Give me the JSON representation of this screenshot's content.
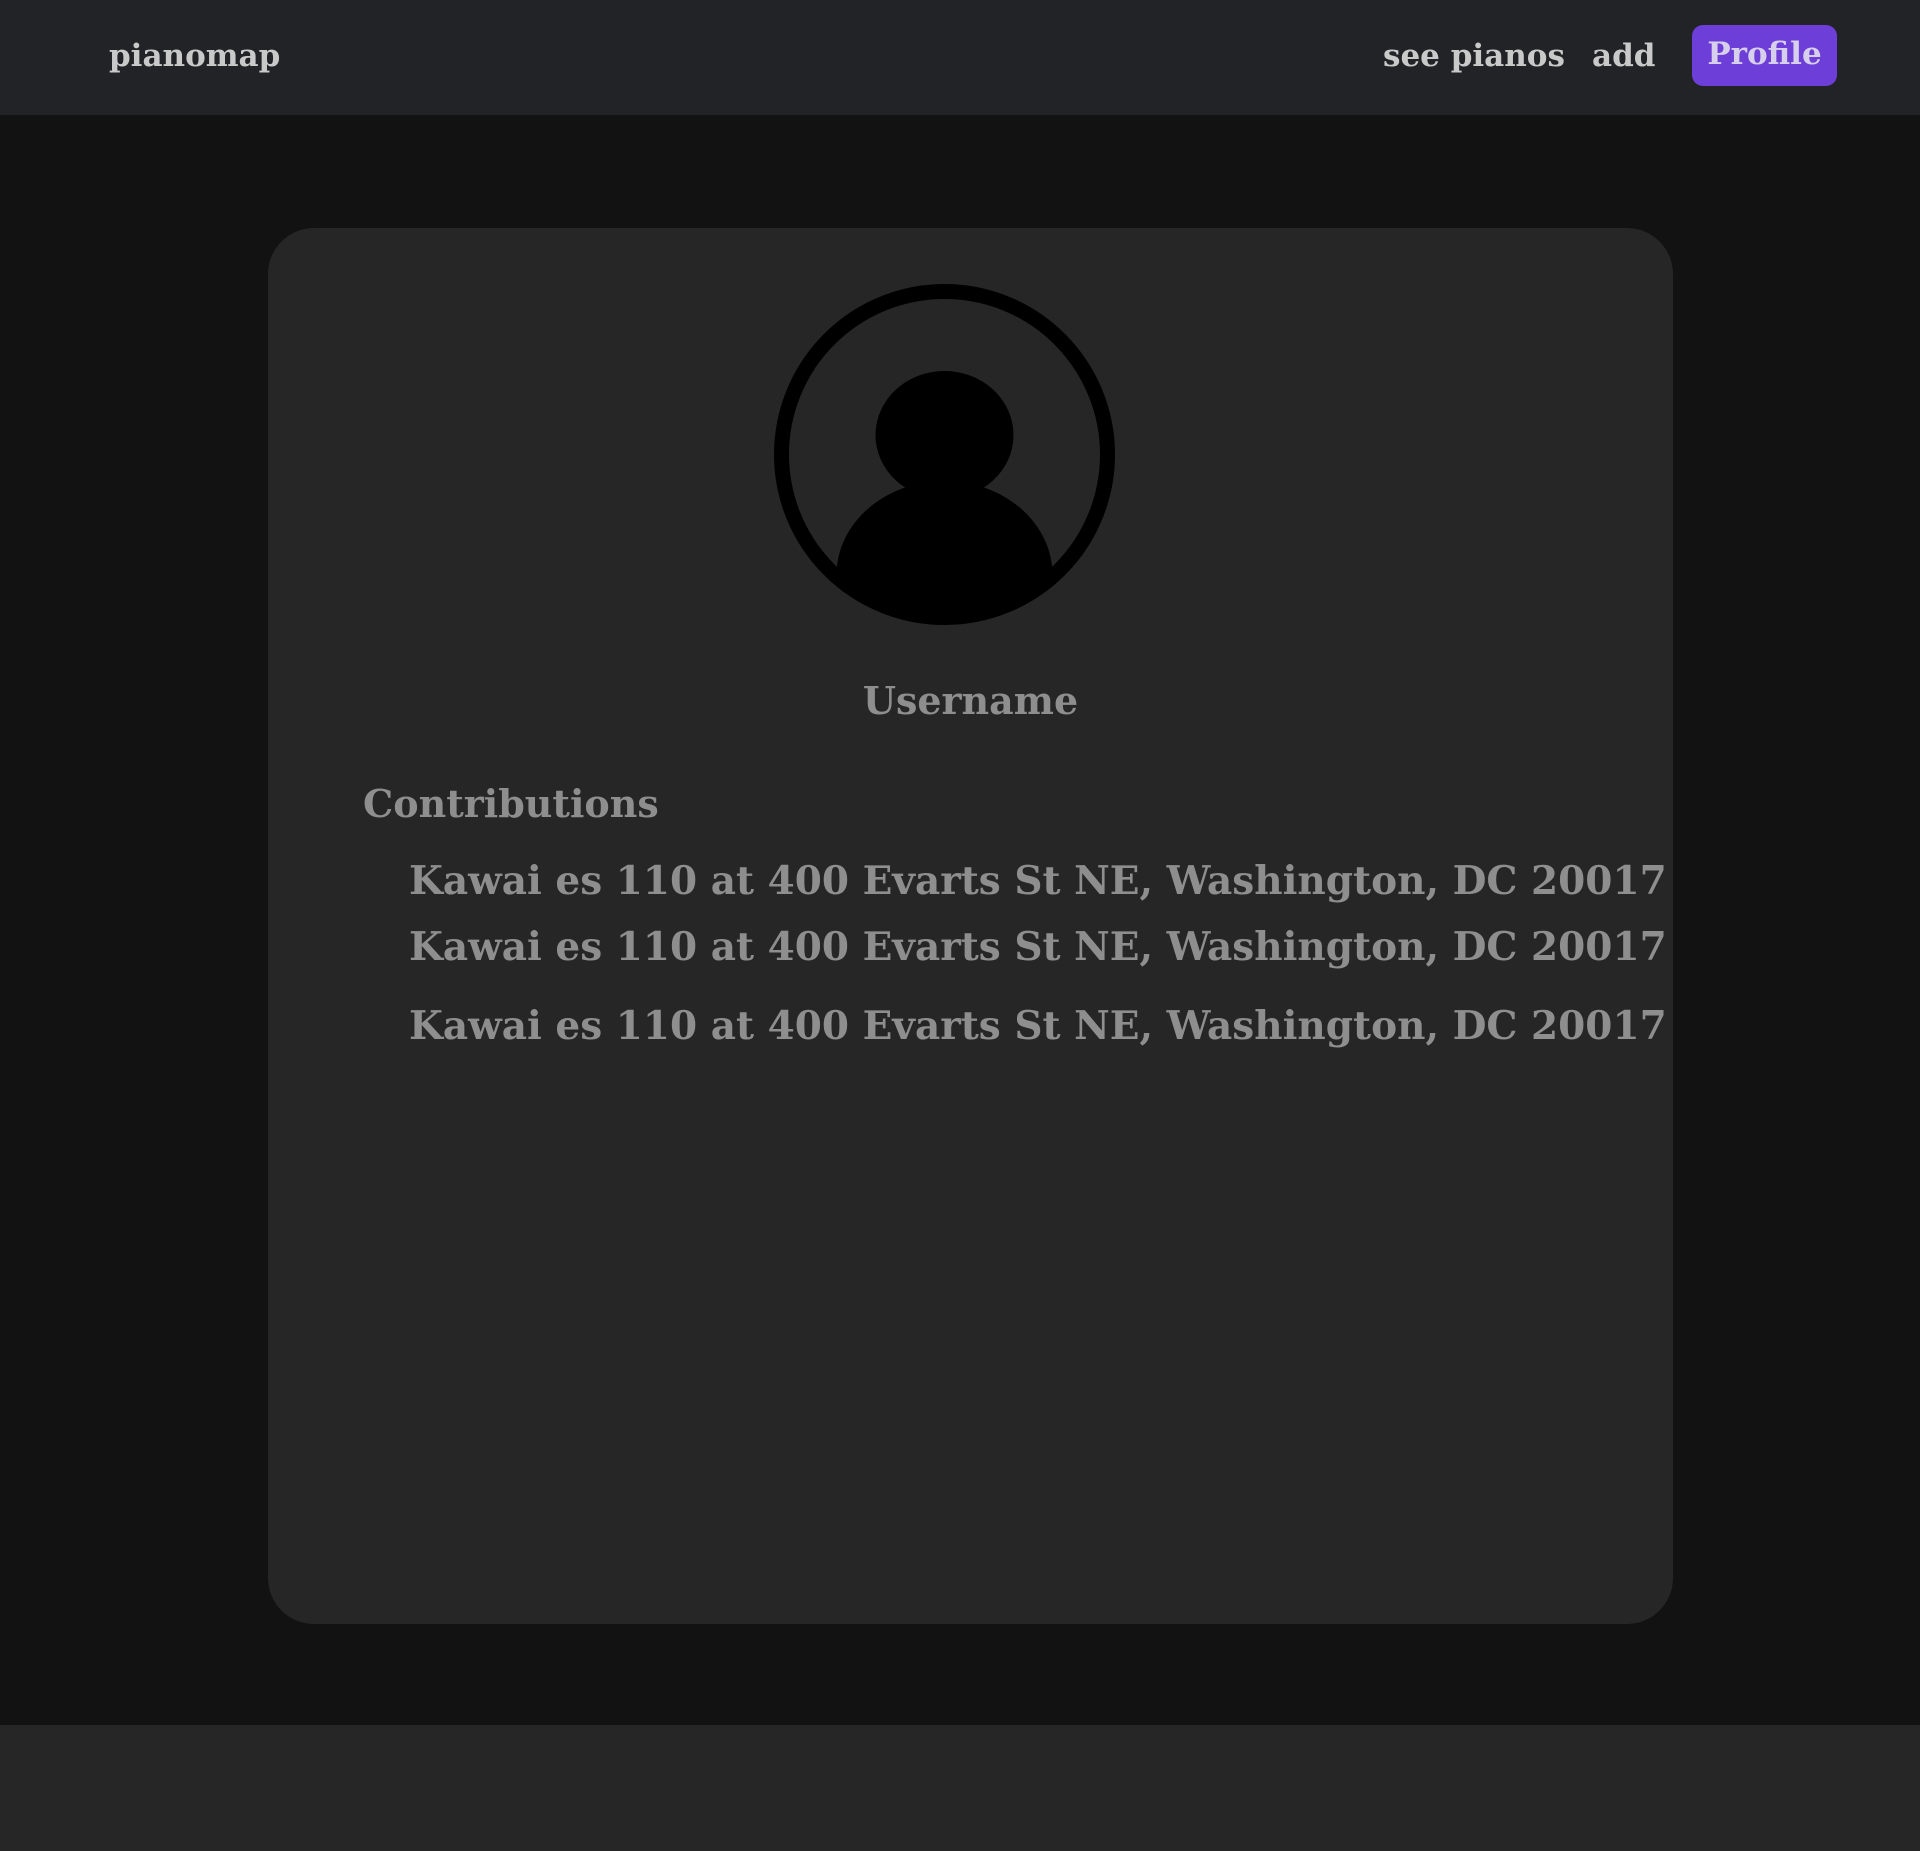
{
  "nav": {
    "brand": "pianomap",
    "see_pianos": "see pianos",
    "add": "add",
    "profile": "Profile"
  },
  "profile": {
    "avatar_icon": "user-avatar-icon",
    "username": "Username",
    "contributions_title": "Contributions",
    "contributions": [
      "Kawai es 110 at 400 Evarts St NE, Washington, DC 20017",
      "Kawai es 110 at 400 Evarts St NE, Washington, DC 20017",
      "Kawai es 110 at 400 Evarts St NE, Washington, DC 20017"
    ]
  },
  "colors": {
    "page_background": "#121212",
    "header_background": "#222326",
    "card_background": "#262626",
    "accent": "#6e3ed8",
    "muted_text": "#8e8e8e"
  }
}
